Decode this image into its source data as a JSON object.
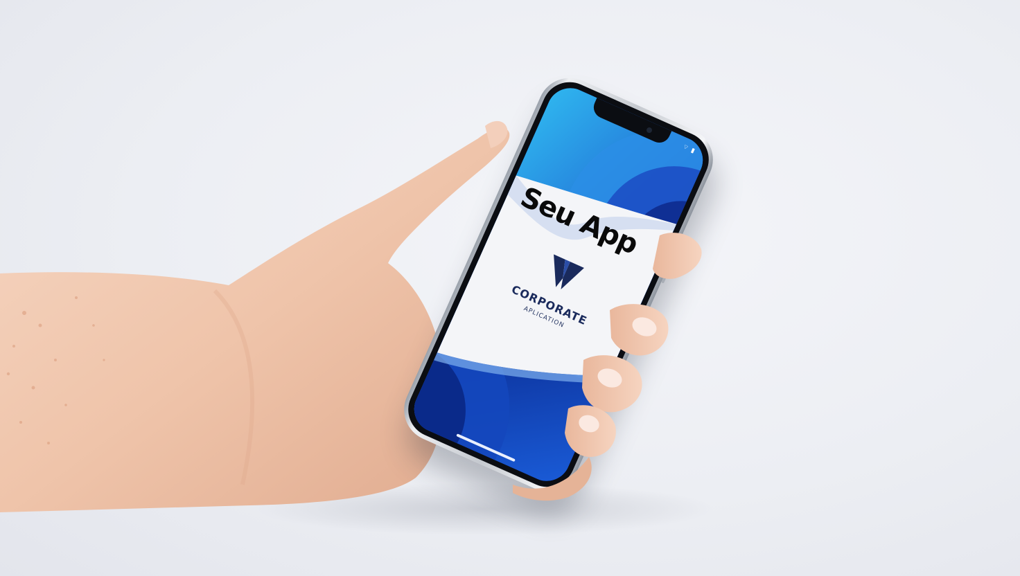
{
  "screen": {
    "title": "Seu App",
    "brand_name": "CORPORATE",
    "brand_subtitle": "APLICATION",
    "status_icons": "wifi-battery-icons"
  },
  "colors": {
    "background": "#eceef3",
    "screen_blue_dark": "#0b2f9e",
    "screen_blue_light": "#2fb6ef",
    "screen_white": "#f4f5f8",
    "logo_navy": "#1a2a5c",
    "skin": "#f1c9b0"
  }
}
